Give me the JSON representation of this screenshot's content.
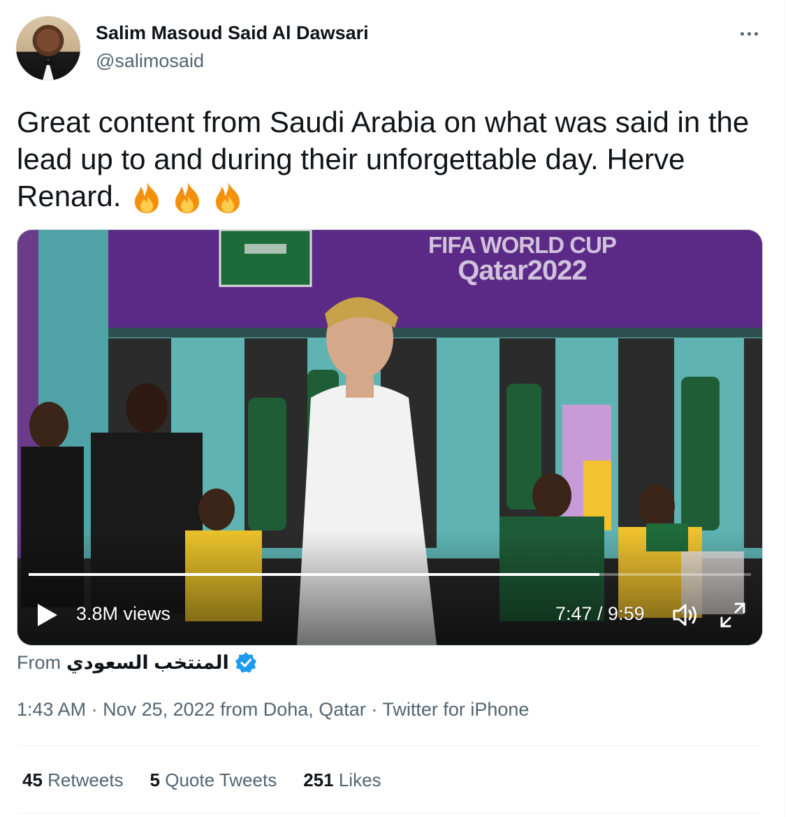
{
  "author": {
    "display_name": "Salim Masoud Said Al Dawsari",
    "handle": "@salimosaid"
  },
  "tweet": {
    "text": "Great content from Saudi Arabia on what was said in the lead up to and during their unforgettable day. Herve Renard.",
    "emoji_count": 3
  },
  "video": {
    "banner_line1": "FIFA WORLD CUP",
    "banner_line2": "Qatar2022",
    "views": "3.8M views",
    "time": "7:47 / 9:59",
    "progress": 0.79
  },
  "source": {
    "prefix": "From",
    "name": "المنتخب السعودي"
  },
  "meta": {
    "time": "1:43 AM",
    "sep1": "·",
    "date_location": "Nov 25, 2022 from Doha, Qatar",
    "sep2": "·",
    "client": "Twitter for iPhone"
  },
  "stats": {
    "retweets_count": "45",
    "retweets_label": "Retweets",
    "quotes_count": "5",
    "quotes_label": "Quote Tweets",
    "likes_count": "251",
    "likes_label": "Likes"
  },
  "colors": {
    "primary_text": "#0f1419",
    "secondary_text": "#536471",
    "verified": "#1d9bf0",
    "banner_purple": "#5b2a86",
    "locker_teal": "#5fb3b3"
  }
}
